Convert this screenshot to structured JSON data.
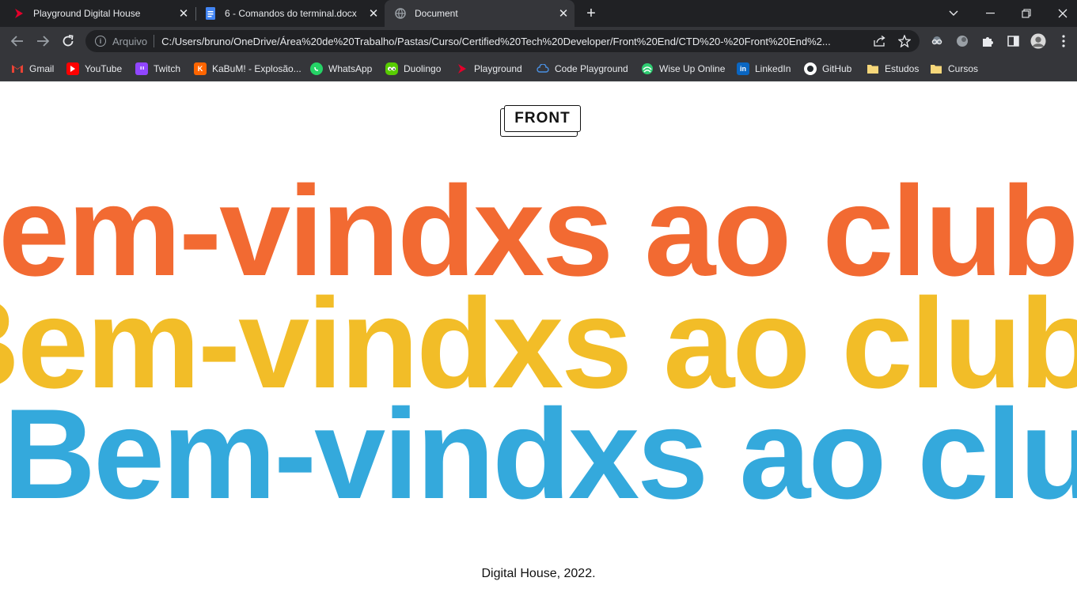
{
  "browser": {
    "tabs": [
      {
        "title": "Playground Digital House",
        "icon": "playground-icon",
        "active": false
      },
      {
        "title": "6 - Comandos do terminal.docx",
        "icon": "google-docs-icon",
        "active": false
      },
      {
        "title": "Document",
        "icon": "globe-icon",
        "active": true
      }
    ],
    "address": {
      "scheme_label": "Arquivo",
      "url": "C:/Users/bruno/OneDrive/Área%20de%20Trabalho/Pastas/Curso/Certified%20Tech%20Developer/Front%20End/CTD%20-%20Front%20End%2..."
    },
    "bookmarks": [
      {
        "label": "Gmail",
        "icon": "gmail-icon",
        "color": "#ea4335"
      },
      {
        "label": "YouTube",
        "icon": "youtube-icon",
        "color": "#ff0000"
      },
      {
        "label": "Twitch",
        "icon": "twitch-icon",
        "color": "#9146ff"
      },
      {
        "label": "KaBuM! - Explosão...",
        "icon": "kabum-icon",
        "color": "#ff6500"
      },
      {
        "label": "WhatsApp",
        "icon": "whatsapp-icon",
        "color": "#25d366"
      },
      {
        "label": "Duolingo",
        "icon": "duolingo-icon",
        "color": "#58cc02"
      },
      {
        "label": "Playground",
        "icon": "playground-icon",
        "color": "#e4002b"
      },
      {
        "label": "Code Playground",
        "icon": "cloud-icon",
        "color": "#4a90e2"
      },
      {
        "label": "Wise Up Online",
        "icon": "wiseup-icon",
        "color": "#2ecc71"
      },
      {
        "label": "LinkedIn",
        "icon": "linkedin-icon",
        "color": "#0a66c2"
      },
      {
        "label": "GitHub",
        "icon": "github-icon",
        "color": "#ffffff"
      },
      {
        "label": "Estudos",
        "icon": "folder-icon",
        "color": "#f6d77a"
      },
      {
        "label": "Cursos",
        "icon": "folder-icon",
        "color": "#f6d77a"
      }
    ]
  },
  "page": {
    "logo_text": "FRONT",
    "marquee_lines": [
      {
        "text": "Bem-vindxs ao clube – Bem-vindxs",
        "color": "#f26a32"
      },
      {
        "text": "Bem-vindxs ao clube – Bem-vindxs",
        "color": "#f2bd28"
      },
      {
        "text": "Bem-vindxs ao clube – Bem-vindxs",
        "color": "#34a9dc"
      }
    ],
    "footer": "Digital House, 2022."
  }
}
